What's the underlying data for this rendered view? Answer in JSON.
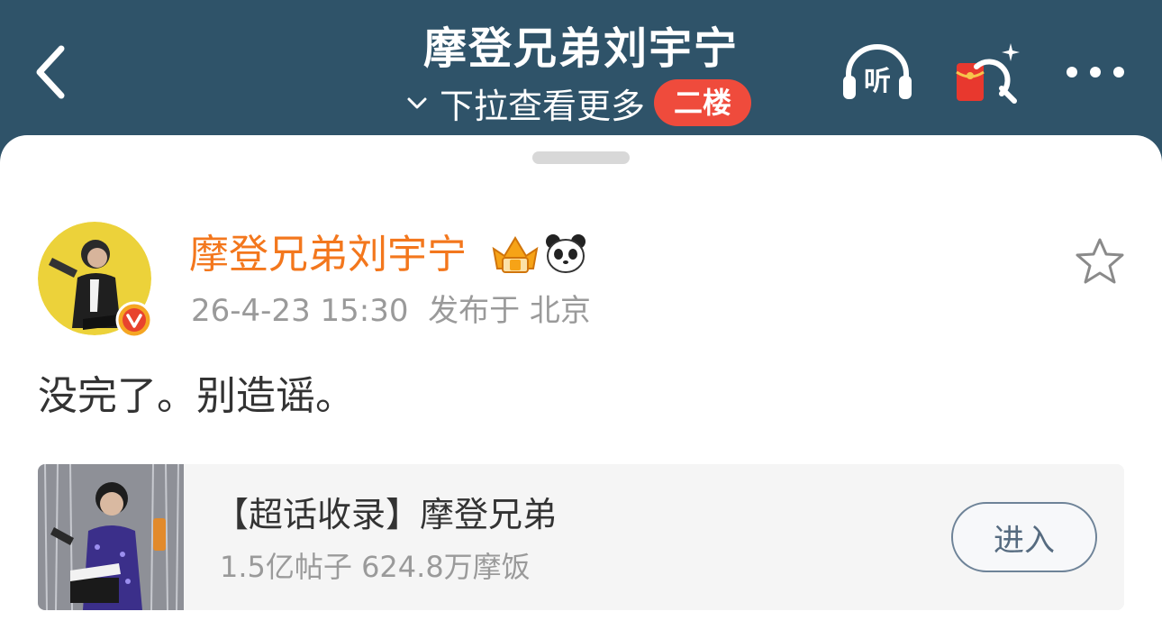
{
  "header": {
    "title": "摩登兄弟刘宇宁",
    "pull_hint": "下拉查看更多",
    "badge": "二楼",
    "listen_label": "听"
  },
  "post": {
    "username": "摩登兄弟刘宇宁",
    "timestamp": "26-4-23 15:30",
    "location": "发布于 北京",
    "text": "没完了。别造谣。"
  },
  "card": {
    "title": "【超话收录】摩登兄弟",
    "stats": "1.5亿帖子 624.8万摩饭",
    "button": "进入"
  },
  "colors": {
    "header_bg": "#2f5369",
    "username": "#f3771d",
    "badge": "#ef4b3c"
  },
  "icons": [
    "back-icon",
    "chevron-down-icon",
    "headphone-icon",
    "red-packet-search-icon",
    "more-icon",
    "verified-badge-icon",
    "crown-badge-icon",
    "panda-icon",
    "star-icon"
  ]
}
